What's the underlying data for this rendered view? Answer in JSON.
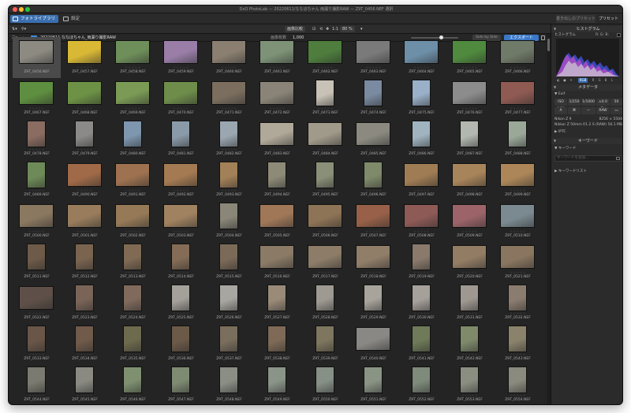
{
  "window": {
    "title": "DxO PhotoLab — 20220611/ななほちゃん 雨漏り撮影RAW — Z9T_0456.NEF 選択"
  },
  "modes": {
    "library": "フォトライブラリ",
    "customize": "設定"
  },
  "header_right": {
    "export_preset": "書き出しのプリセット",
    "presets": "プリセット"
  },
  "toolbar": {
    "compare": "画像比較",
    "zoom_value": "1:1",
    "zoom_percent": "80 %",
    "ratio": "1:1"
  },
  "pathbar": {
    "folder": "20220611 ななほちゃん_雨漏り撮影RAW",
    "count_label": "画像枚数",
    "count_value": "1,000",
    "side_by_side": "Side by Side",
    "export": "エクスポート"
  },
  "rating_placeholder": "☆☆☆☆☆",
  "photos": [
    {
      "name": "Z9T_0456.NEF",
      "o": "l",
      "c": "#8d8a82"
    },
    {
      "name": "Z9T_0457.NEF",
      "o": "l",
      "c": "#d8b835"
    },
    {
      "name": "Z9T_0458.NEF",
      "o": "l",
      "c": "#6e8f5a"
    },
    {
      "name": "Z9T_0459.NEF",
      "o": "l",
      "c": "#9a7ea8"
    },
    {
      "name": "Z9T_0460.NEF",
      "o": "l",
      "c": "#8a7f70"
    },
    {
      "name": "Z9T_0461.NEF",
      "o": "l",
      "c": "#7d9277"
    },
    {
      "name": "Z9T_0462.NEF",
      "o": "l",
      "c": "#4e7d3d"
    },
    {
      "name": "Z9T_0463.NEF",
      "o": "l",
      "c": "#7a7a7a"
    },
    {
      "name": "Z9T_0464.NEF",
      "o": "l",
      "c": "#6d8fa8"
    },
    {
      "name": "Z9T_0465.NEF",
      "o": "l",
      "c": "#4f8a3e"
    },
    {
      "name": "Z9T_0466.NEF",
      "o": "l",
      "c": "#6f7a68"
    },
    {
      "name": "Z9T_0467.NEF",
      "o": "l",
      "c": "#5e8e3f"
    },
    {
      "name": "Z9T_0468.NEF",
      "o": "l",
      "c": "#6d9245"
    },
    {
      "name": "Z9T_0469.NEF",
      "o": "l",
      "c": "#7a9a55"
    },
    {
      "name": "Z9T_0470.NEF",
      "o": "l",
      "c": "#6e8d4a"
    },
    {
      "name": "Z9T_0471.NEF",
      "o": "l",
      "c": "#7b6e5f"
    },
    {
      "name": "Z9T_0472.NEF",
      "o": "l",
      "c": "#8a8478"
    },
    {
      "name": "Z9T_0473.NEF",
      "o": "p",
      "c": "#c8c2b6"
    },
    {
      "name": "Z9T_0474.NEF",
      "o": "p",
      "c": "#7a8aa0"
    },
    {
      "name": "Z9T_0475.NEF",
      "o": "p",
      "c": "#9ab0c8"
    },
    {
      "name": "Z9T_0476.NEF",
      "o": "l",
      "c": "#8c8c8c"
    },
    {
      "name": "Z9T_0477.NEF",
      "o": "l",
      "c": "#8e5a52"
    },
    {
      "name": "Z9T_0478.NEF",
      "o": "p",
      "c": "#8a6c60"
    },
    {
      "name": "Z9T_0479.NEF",
      "o": "p",
      "c": "#8b8a88"
    },
    {
      "name": "Z9T_0480.NEF",
      "o": "p",
      "c": "#7e96ae"
    },
    {
      "name": "Z9T_0481.NEF",
      "o": "p",
      "c": "#8a9aa8"
    },
    {
      "name": "Z9T_0482.NEF",
      "o": "p",
      "c": "#9aa6b0"
    },
    {
      "name": "Z9T_0483.NEF",
      "o": "l",
      "c": "#b0a898"
    },
    {
      "name": "Z9T_0484.NEF",
      "o": "l",
      "c": "#a09a8a"
    },
    {
      "name": "Z9T_0485.NEF",
      "o": "l",
      "c": "#8c8a80"
    },
    {
      "name": "Z9T_0486.NEF",
      "o": "p",
      "c": "#a0b4c0"
    },
    {
      "name": "Z9T_0487.NEF",
      "o": "p",
      "c": "#b2b8b0"
    },
    {
      "name": "Z9T_0488.NEF",
      "o": "p",
      "c": "#9aa898"
    },
    {
      "name": "Z9T_0489.NEF",
      "o": "p",
      "c": "#6e8a58"
    },
    {
      "name": "Z9T_0490.NEF",
      "o": "l",
      "c": "#a06a48"
    },
    {
      "name": "Z9T_0491.NEF",
      "o": "l",
      "c": "#9e7250"
    },
    {
      "name": "Z9T_0492.NEF",
      "o": "l",
      "c": "#a47a52"
    },
    {
      "name": "Z9T_0493.NEF",
      "o": "p",
      "c": "#a28058"
    },
    {
      "name": "Z9T_0494.NEF",
      "o": "p",
      "c": "#8e8a78"
    },
    {
      "name": "Z9T_0495.NEF",
      "o": "p",
      "c": "#8a9078"
    },
    {
      "name": "Z9T_0496.NEF",
      "o": "p",
      "c": "#7e8a6a"
    },
    {
      "name": "Z9T_0497.NEF",
      "o": "l",
      "c": "#a07c54"
    },
    {
      "name": "Z9T_0498.NEF",
      "o": "l",
      "c": "#a8845a"
    },
    {
      "name": "Z9T_0499.NEF",
      "o": "l",
      "c": "#ac8658"
    },
    {
      "name": "Z9T_0500.NEF",
      "o": "l",
      "c": "#8a7860"
    },
    {
      "name": "Z9T_0501.NEF",
      "o": "l",
      "c": "#987c5c"
    },
    {
      "name": "Z9T_0502.NEF",
      "o": "l",
      "c": "#967a58"
    },
    {
      "name": "Z9T_0503.NEF",
      "o": "l",
      "c": "#a08260"
    },
    {
      "name": "Z9T_0504.NEF",
      "o": "p",
      "c": "#8a8678"
    },
    {
      "name": "Z9T_0505.NEF",
      "o": "l",
      "c": "#a07858"
    },
    {
      "name": "Z9T_0506.NEF",
      "o": "l",
      "c": "#8e7456"
    },
    {
      "name": "Z9T_0507.NEF",
      "o": "l",
      "c": "#986048"
    },
    {
      "name": "Z9T_0508.NEF",
      "o": "l",
      "c": "#8e5a56"
    },
    {
      "name": "Z9T_0509.NEF",
      "o": "l",
      "c": "#9c6468"
    },
    {
      "name": "Z9T_0510.NEF",
      "o": "l",
      "c": "#7a8a90"
    },
    {
      "name": "Z9T_0511.NEF",
      "o": "p",
      "c": "#6e5a48"
    },
    {
      "name": "Z9T_0512.NEF",
      "o": "p",
      "c": "#7a6450"
    },
    {
      "name": "Z9T_0513.NEF",
      "o": "p",
      "c": "#806a54"
    },
    {
      "name": "Z9T_0514.NEF",
      "o": "p",
      "c": "#846c56"
    },
    {
      "name": "Z9T_0515.NEF",
      "o": "p",
      "c": "#7c6a58"
    },
    {
      "name": "Z9T_0516.NEF",
      "o": "l",
      "c": "#8a7a66"
    },
    {
      "name": "Z9T_0517.NEF",
      "o": "l",
      "c": "#8c7c68"
    },
    {
      "name": "Z9T_0518.NEF",
      "o": "l",
      "c": "#907e68"
    },
    {
      "name": "Z9T_0519.NEF",
      "o": "p",
      "c": "#8a7a6c"
    },
    {
      "name": "Z9T_0520.NEF",
      "o": "l",
      "c": "#927c64"
    },
    {
      "name": "Z9T_0521.NEF",
      "o": "l",
      "c": "#8a7660"
    },
    {
      "name": "Z9T_0522.NEF",
      "o": "l",
      "c": "#5e5048"
    },
    {
      "name": "Z9T_0523.NEF",
      "o": "p",
      "c": "#7a6458"
    },
    {
      "name": "Z9T_0524.NEF",
      "o": "p",
      "c": "#806a5c"
    },
    {
      "name": "Z9T_0525.NEF",
      "o": "p",
      "c": "#a4a09a"
    },
    {
      "name": "Z9T_0526.NEF",
      "o": "p",
      "c": "#a8a6a0"
    },
    {
      "name": "Z9T_0527.NEF",
      "o": "p",
      "c": "#9a8a78"
    },
    {
      "name": "Z9T_0528.NEF",
      "o": "p",
      "c": "#9e9a92"
    },
    {
      "name": "Z9T_0529.NEF",
      "o": "p",
      "c": "#a8a49c"
    },
    {
      "name": "Z9T_0530.NEF",
      "o": "p",
      "c": "#a6a09a"
    },
    {
      "name": "Z9T_0531.NEF",
      "o": "p",
      "c": "#9e9890"
    },
    {
      "name": "Z9T_0532.NEF",
      "o": "p",
      "c": "#8a7c6e"
    },
    {
      "name": "Z9T_0533.NEF",
      "o": "p",
      "c": "#6a5648"
    },
    {
      "name": "Z9T_0534.NEF",
      "o": "p",
      "c": "#705a4a"
    },
    {
      "name": "Z9T_0535.NEF",
      "o": "p",
      "c": "#6e6a4e"
    },
    {
      "name": "Z9T_0536.NEF",
      "o": "p",
      "c": "#6c5a48"
    },
    {
      "name": "Z9T_0537.NEF",
      "o": "p",
      "c": "#7a6e5c"
    },
    {
      "name": "Z9T_0538.NEF",
      "o": "p",
      "c": "#7e6a56"
    },
    {
      "name": "Z9T_0539.NEF",
      "o": "p",
      "c": "#7e765e"
    },
    {
      "name": "Z9T_0540.NEF",
      "o": "l",
      "c": "#8a8884"
    },
    {
      "name": "Z9T_0541.NEF",
      "o": "p",
      "c": "#6e7a58"
    },
    {
      "name": "Z9T_0542.NEF",
      "o": "p",
      "c": "#7e8a6a"
    },
    {
      "name": "Z9T_0543.NEF",
      "o": "p",
      "c": "#8a826a"
    },
    {
      "name": "Z9T_0544.NEF",
      "o": "p",
      "c": "#7a7a70"
    },
    {
      "name": "Z9T_0545.NEF",
      "o": "p",
      "c": "#8a8a82"
    },
    {
      "name": "Z9T_0546.NEF",
      "o": "p",
      "c": "#7e9070"
    },
    {
      "name": "Z9T_0547.NEF",
      "o": "p",
      "c": "#7e8a72"
    },
    {
      "name": "Z9T_0548.NEF",
      "o": "p",
      "c": "#8a8e84"
    },
    {
      "name": "Z9T_0549.NEF",
      "o": "p",
      "c": "#8a9488"
    },
    {
      "name": "Z9T_0550.NEF",
      "o": "p",
      "c": "#869086"
    },
    {
      "name": "Z9T_0551.NEF",
      "o": "p",
      "c": "#8a9484"
    },
    {
      "name": "Z9T_0552.NEF",
      "o": "p",
      "c": "#7e8a7a"
    },
    {
      "name": "Z9T_0553.NEF",
      "o": "p",
      "c": "#8a8e80"
    },
    {
      "name": "Z9T_0554.NEF",
      "o": "p",
      "c": "#8a8a7e"
    }
  ],
  "panel": {
    "histogram_title": "ヒストグラム",
    "histogram_sub": "ヒストグラム",
    "histogram_rgb": "R: G: B:",
    "histogram_mode": "RGB",
    "metadata_title": "メタデータ",
    "exif_label": "Exif",
    "exif_row1": [
      "ISO 100",
      "1/250",
      "1/1000 s",
      "±0.0 EV",
      "50 mm"
    ],
    "exif_row2": [
      "A",
      "",
      "—",
      "RAW",
      ""
    ],
    "camera": "Nikon Z 9",
    "resolution": "8256 × 5504",
    "lens": "Nikkor Z 50mm f/1.2 S (RAW)",
    "filesize": "56.1 MB",
    "iptc": "IPTC",
    "keywords_title": "キーワード",
    "keywords_sub": "キーワード",
    "keywords_placeholder": "キーワードを追加...",
    "keyword_list": "キーワードリスト"
  }
}
